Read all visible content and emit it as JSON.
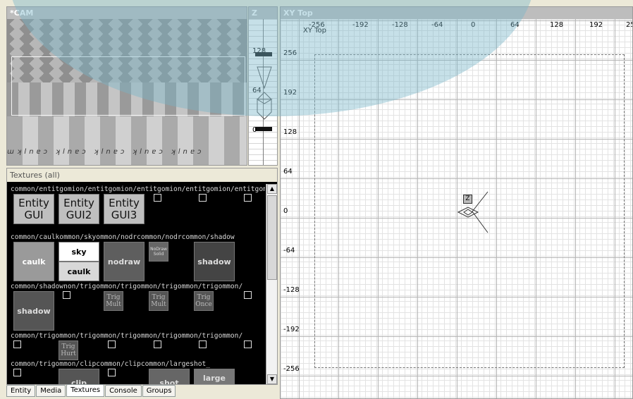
{
  "cam": {
    "title": "*CAM",
    "caulk_text": "ɯʞlnɐɔ ʞlnɐɔ ʞlnɐɔ ʞlnɐɔ ʞlnɐɔ"
  },
  "z": {
    "title": "Z",
    "labels": [
      "128",
      "64",
      "0"
    ]
  },
  "xy": {
    "title": "XY Top",
    "subtitle": "XY Top",
    "x_labels": [
      "-256",
      "-192",
      "-128",
      "-64",
      "0",
      "64",
      "128",
      "192",
      "25"
    ],
    "y_labels": [
      "256",
      "192",
      "128",
      "64",
      "0",
      "-64",
      "-128",
      "-192",
      "-256"
    ],
    "entity_label": "Z"
  },
  "textures": {
    "title": "Textures (all)",
    "rows": [
      "common/entitgomion/entitgomion/entitgomion/entitgomion/entitgomion/",
      "common/caulkommon/skyommon/nodrcommon/nodrcommon/shadow",
      "common/shadownon/trigommon/trigommon/trigommon/trigommon/",
      "common/trigommon/trigommon/trigommon/trigommon/trigommon/",
      "common/trigommon/clipcommon/clipcommon/largeshot_"
    ],
    "items": {
      "gui1": "Entity GUI",
      "gui2": "Entity GUI2",
      "gui3": "Entity GUI3",
      "caulk": "caulk",
      "sky": "sky",
      "sky_sub": "caulk",
      "nodraw": "nodraw",
      "nodraw_solid": "NoDraw Solid",
      "shadow": "shadow",
      "shadow2": "shadow",
      "trig_mult1": "Trig Mult",
      "trig_mult2": "Trig Mult",
      "trig_once": "Trig Once",
      "trig_hurt": "Trig Hurt",
      "clip": "clip",
      "shot": "shot",
      "large_shot": "large shot"
    }
  },
  "tabs": [
    "Entity",
    "Media",
    "Textures",
    "Console",
    "Groups"
  ],
  "active_tab": "Textures"
}
